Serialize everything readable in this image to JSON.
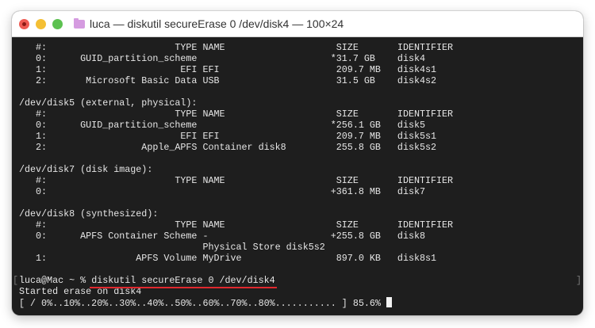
{
  "window": {
    "title": "luca — diskutil secureErase 0 /dev/disk4 — 100×24"
  },
  "terminal": {
    "lines": [
      "   #:                       TYPE NAME                    SIZE       IDENTIFIER",
      "   0:      GUID_partition_scheme                        *31.7 GB    disk4",
      "   1:                        EFI EFI                     209.7 MB   disk4s1",
      "   2:       Microsoft Basic Data USB                     31.5 GB    disk4s2",
      "",
      "/dev/disk5 (external, physical):",
      "   #:                       TYPE NAME                    SIZE       IDENTIFIER",
      "   0:      GUID_partition_scheme                        *256.1 GB   disk5",
      "   1:                        EFI EFI                     209.7 MB   disk5s1",
      "   2:                 Apple_APFS Container disk8         255.8 GB   disk5s2",
      "",
      "/dev/disk7 (disk image):",
      "   #:                       TYPE NAME                    SIZE       IDENTIFIER",
      "   0:                                                   +361.8 MB   disk7",
      "",
      "/dev/disk8 (synthesized):",
      "   #:                       TYPE NAME                    SIZE       IDENTIFIER",
      "   0:      APFS Container Scheme -                      +255.8 GB   disk8",
      "                                 Physical Store disk5s2",
      "   1:                APFS Volume MyDrive                 897.0 KB   disk8s1",
      ""
    ],
    "prompt": "luca@Mac ~ % ",
    "command": "diskutil secureErase 0 /dev/disk4",
    "output": [
      "Started erase on disk4",
      "[ / 0%..10%..20%..30%..40%..50%..60%..70%..80%........... ] 85.6% "
    ],
    "progress_percent": 85.6
  },
  "colors": {
    "background": "#1e1e1e",
    "text": "#e6e6e6",
    "underline": "#e0282e"
  }
}
